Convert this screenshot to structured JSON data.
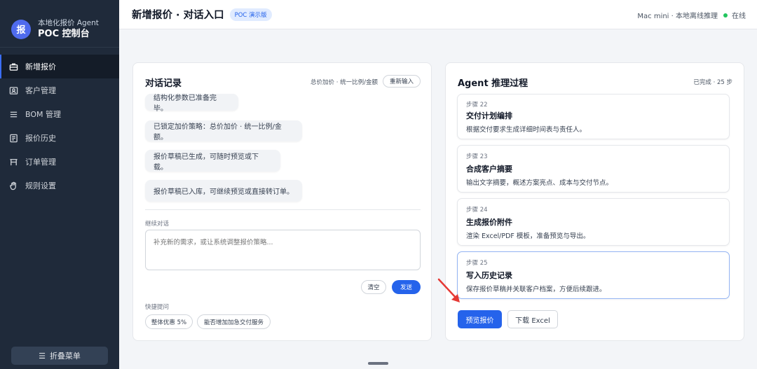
{
  "brand": {
    "logo_char": "报",
    "subtitle": "本地化报价 Agent",
    "title": "POC 控制台"
  },
  "sidebar": {
    "items": [
      {
        "label": "新增报价",
        "icon": "briefcase-icon",
        "active": true
      },
      {
        "label": "客户管理",
        "icon": "id-card-icon"
      },
      {
        "label": "BOM 管理",
        "icon": "list-icon"
      },
      {
        "label": "报价历史",
        "icon": "document-icon"
      },
      {
        "label": "订单管理",
        "icon": "table-icon"
      },
      {
        "label": "规则设置",
        "icon": "hand-icon"
      }
    ],
    "collapse_label": "折叠菜单"
  },
  "header": {
    "title": "新增报价 · 对话入口",
    "badge": "POC 演示版",
    "device": "Mac mini · 本地离线推理",
    "status": "在线",
    "status_color": "#22c55e"
  },
  "chat": {
    "title": "对话记录",
    "meta": "总价加价 · 统一比例/金额",
    "reset_label": "重新输入",
    "messages": [
      "结构化参数已准备完毕。",
      "已锁定加价策略：总价加价 · 统一比例/金额。",
      "报价草稿已生成，可随时预览或下载。",
      "报价草稿已入库，可继续预览或直接转订单。"
    ],
    "continue_label": "继续对话",
    "input_placeholder": "补充新的需求，或让系统调整报价策略...",
    "clear_label": "清空",
    "send_label": "发送",
    "quick_label": "快捷提问",
    "quick_chips": [
      "整体优惠 5%",
      "能否增加加急交付服务"
    ]
  },
  "agent": {
    "title": "Agent 推理过程",
    "meta": "已完成 · 25 步",
    "steps": [
      {
        "num": "步骤 22",
        "name": "交付计划编排",
        "desc": "根据交付要求生成详细时间表与责任人。"
      },
      {
        "num": "步骤 23",
        "name": "合成客户摘要",
        "desc": "输出文字摘要，概述方案亮点、成本与交付节点。"
      },
      {
        "num": "步骤 24",
        "name": "生成报价附件",
        "desc": "渲染 Excel/PDF 模板，准备预览与导出。"
      },
      {
        "num": "步骤 25",
        "name": "写入历史记录",
        "desc": "保存报价草稿并关联客户档案，方便后续跟进。"
      }
    ],
    "preview_label": "预览报价",
    "download_label": "下载 Excel"
  },
  "colors": {
    "accent": "#2563eb",
    "sidebar_bg": "#1f2a3a",
    "annotation_arrow": "#e53935"
  }
}
